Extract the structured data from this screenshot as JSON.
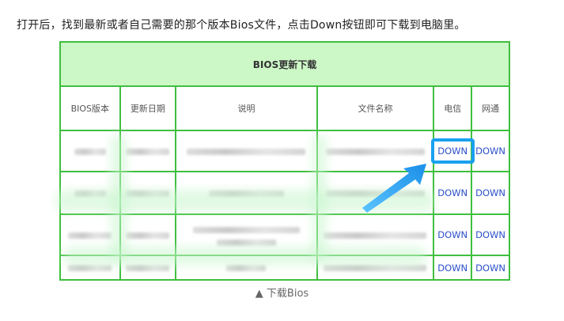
{
  "instruction": "打开后，找到最新或者自己需要的那个版本Bios文件，点击Down按钮即可下载到电脑里。",
  "table": {
    "title": "BIOS更新下载",
    "headers": [
      "BIOS版本",
      "更新日期",
      "说明",
      "文件名称",
      "电信",
      "网通"
    ],
    "rows": [
      {
        "telecom": "DOWN",
        "netcom": "DOWN"
      },
      {
        "telecom": "DOWN",
        "netcom": "DOWN"
      },
      {
        "telecom": "DOWN",
        "netcom": "DOWN"
      },
      {
        "telecom": "DOWN",
        "netcom": "DOWN"
      }
    ]
  },
  "caption": "▲ 下载Bios",
  "colors": {
    "border": "#3fbf3f",
    "title_bg": "#ccf7c6",
    "highlight": "#1aa0f0",
    "link": "#2b4fc9"
  }
}
